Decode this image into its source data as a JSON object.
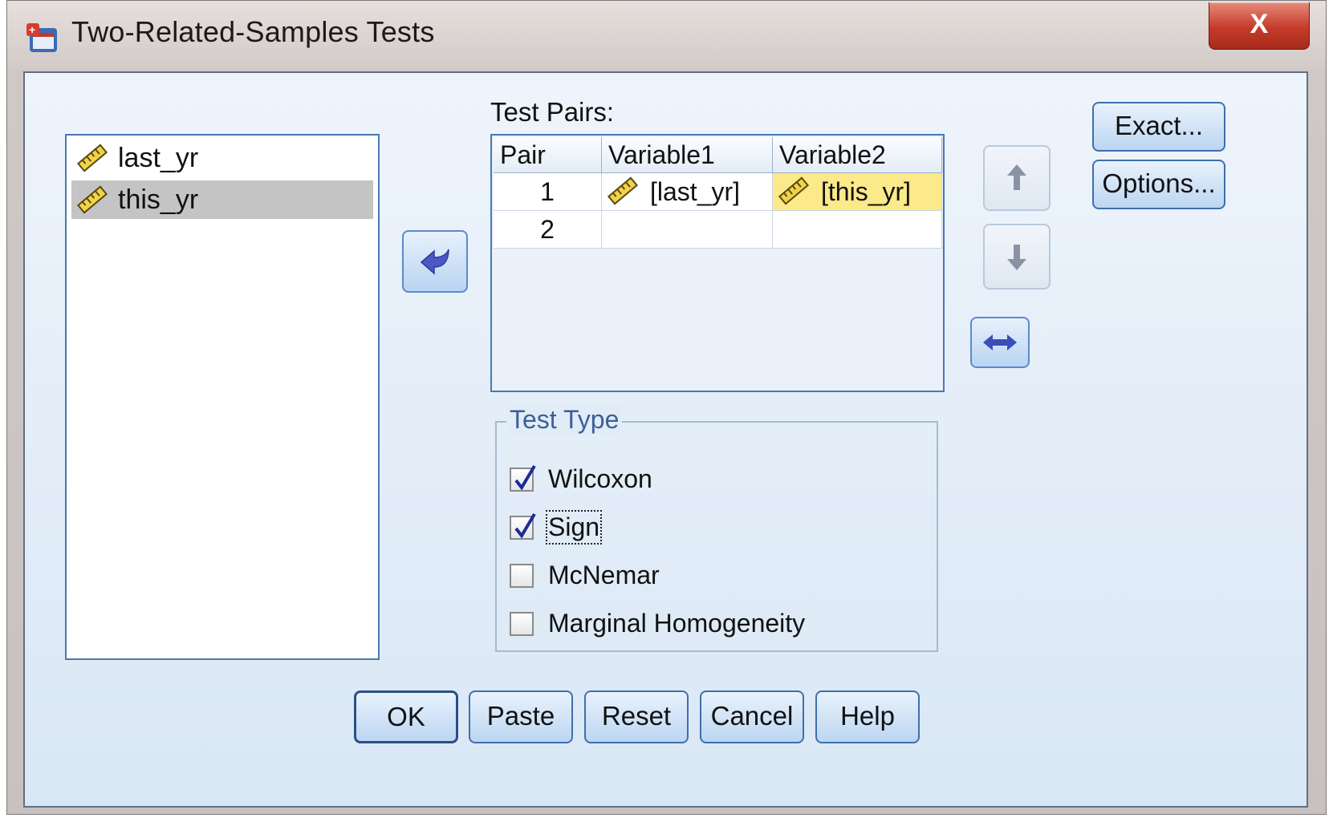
{
  "window": {
    "title": "Two-Related-Samples Tests",
    "close_label": "X"
  },
  "source_list": {
    "items": [
      {
        "label": "last_yr",
        "selected": false
      },
      {
        "label": "this_yr",
        "selected": true
      }
    ]
  },
  "test_pairs": {
    "label": "Test Pairs:",
    "columns": [
      "Pair",
      "Variable1",
      "Variable2"
    ],
    "rows": [
      {
        "pair": "1",
        "variable1": "[last_yr]",
        "variable2": "[this_yr]"
      },
      {
        "pair": "2",
        "variable1": "",
        "variable2": ""
      }
    ]
  },
  "test_type": {
    "title": "Test Type",
    "options": [
      {
        "label": "Wilcoxon",
        "checked": true
      },
      {
        "label": "Sign",
        "checked": true
      },
      {
        "label": "McNemar",
        "checked": false
      },
      {
        "label": "Marginal Homogeneity",
        "checked": false
      }
    ]
  },
  "side_buttons": {
    "exact": "Exact...",
    "options": "Options..."
  },
  "buttons": {
    "ok": "OK",
    "paste": "Paste",
    "reset": "Reset",
    "cancel": "Cancel",
    "help": "Help"
  },
  "colors": {
    "accent": "#3f6fad",
    "selection": "#c4c4c4",
    "highlight": "#fbe98a",
    "close": "#c63b2a"
  }
}
